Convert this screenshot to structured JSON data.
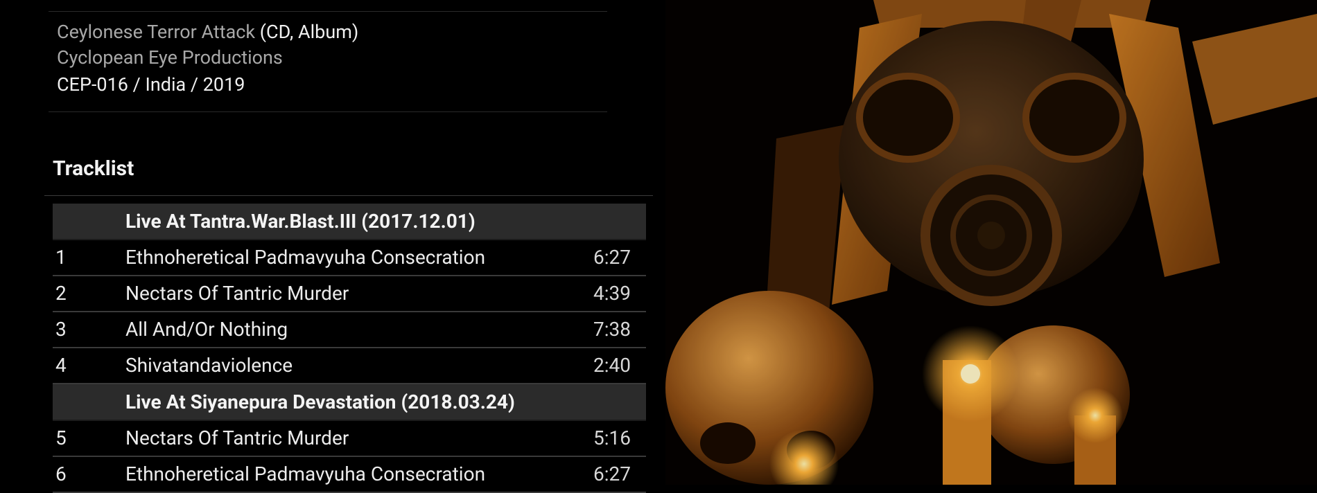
{
  "release": {
    "title": "Ceylonese Terror Attack",
    "format": "(CD, Album)",
    "label": "Cyclopean Eye Productions",
    "catalog_line": "CEP-016 / India / 2019"
  },
  "tracklist": {
    "heading": "Tracklist",
    "sections": [
      {
        "name": "Live At Tantra.War.Blast.III (2017.12.01)",
        "tracks": [
          {
            "number": "1",
            "title": "Ethnoheretical Padmavyuha Consecration",
            "length": "6:27"
          },
          {
            "number": "2",
            "title": "Nectars Of Tantric Murder",
            "length": "4:39"
          },
          {
            "number": "3",
            "title": "All And/Or Nothing",
            "length": "7:38"
          },
          {
            "number": "4",
            "title": "Shivatandaviolence",
            "length": "2:40"
          }
        ]
      },
      {
        "name": "Live At Siyanepura Devastation (2018.03.24)",
        "tracks": [
          {
            "number": "5",
            "title": "Nectars Of Tantric Murder",
            "length": "5:16"
          },
          {
            "number": "6",
            "title": "Ethnoheretical Padmavyuha Consecration",
            "length": "6:27"
          }
        ]
      }
    ]
  },
  "artwork": {
    "subject": "gas-mask-skull-candles",
    "accent": "#e08a1e",
    "glow": "#ffb43a"
  }
}
